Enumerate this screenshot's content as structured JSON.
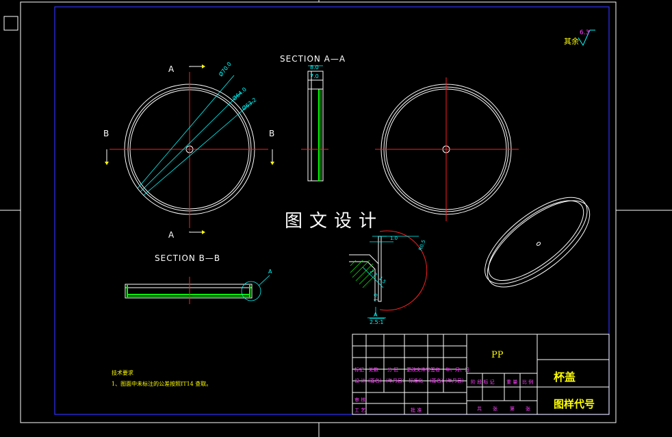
{
  "labels": {
    "section_aa": "SECTION A—A",
    "section_bb": "SECTION B—B",
    "a_top": "A",
    "a_bottom": "A",
    "b_left": "B",
    "b_right": "B",
    "watermark": "图文设计",
    "detail_a": "A",
    "detail_a_label": "A",
    "detail_scale": "2.5:1"
  },
  "dims": {
    "d1": "Ø70.0",
    "d2": "Ø64.0",
    "d3": "Ø63.2",
    "w80": "8.0",
    "w70": "7.0",
    "d_1_0a": "1.0",
    "d_1_0b": "1.0",
    "d_r05": "R0.5",
    "d_27": "2.7",
    "d_15": "1.5"
  },
  "roughness": {
    "text": "其余",
    "value": "6.3"
  },
  "notes": {
    "title": "技术要求",
    "item1": "1、图面中未标注的公差按照IT14 查取。"
  },
  "title_block": {
    "material": "PP",
    "part_name": "杯盖",
    "drawing_code": "图样代号",
    "row_hdr": [
      "标记",
      "处数",
      "分 区",
      "更改文件号",
      "签名",
      "年、月、日"
    ],
    "row_design": [
      "设 计",
      "(签名)",
      "(年月日)",
      "标准化",
      "(签名)",
      "(年月日)"
    ],
    "review": "审 核",
    "process": "工 艺",
    "approve": "批 准",
    "stage_hdr": [
      "阶 段 标 记",
      "重 量",
      "比 例"
    ],
    "sheets": [
      "共",
      "张",
      "第",
      "张"
    ]
  },
  "colors": {
    "outline": "#ffffff",
    "center": "#ff2020",
    "dimension": "#00ffff",
    "frame": "#3030ff",
    "hatch": "#00ff00",
    "text_yellow": "#ffff00",
    "text_magenta": "#ff40ff"
  }
}
